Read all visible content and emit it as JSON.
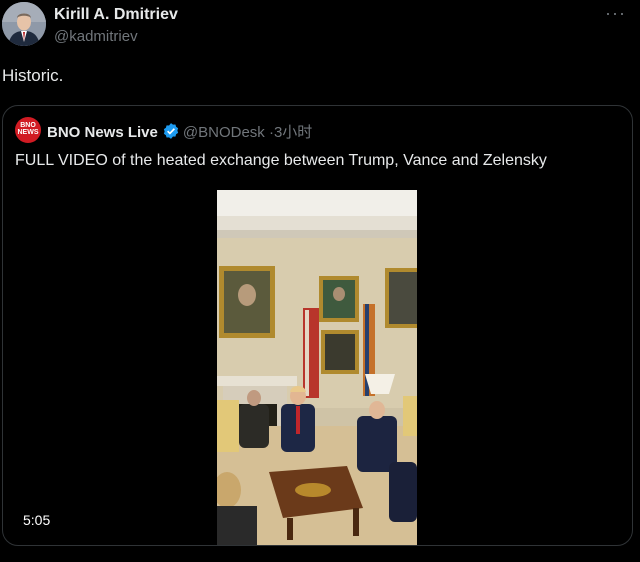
{
  "author": {
    "name": "Kirill A. Dmitriev",
    "handle": "@kadmitriev"
  },
  "tweet": {
    "text": "Historic."
  },
  "quoted": {
    "avatar_text_line1": "BNO",
    "avatar_text_line2": "NEWS",
    "name": "BNO News Live",
    "handle": "@BNODesk",
    "separator": "·",
    "time": "3小时",
    "text": "FULL VIDEO of the heated exchange between Trump, Vance and Zelensky",
    "video": {
      "duration": "5:05"
    }
  },
  "icons": {
    "more": "more-horizontal-icon",
    "verified": "verified-badge-icon"
  },
  "colors": {
    "background": "#000000",
    "text_primary": "#e7e9ea",
    "text_secondary": "#71767b",
    "verified": "#1d9bf0",
    "bno_red": "#d11b23"
  }
}
